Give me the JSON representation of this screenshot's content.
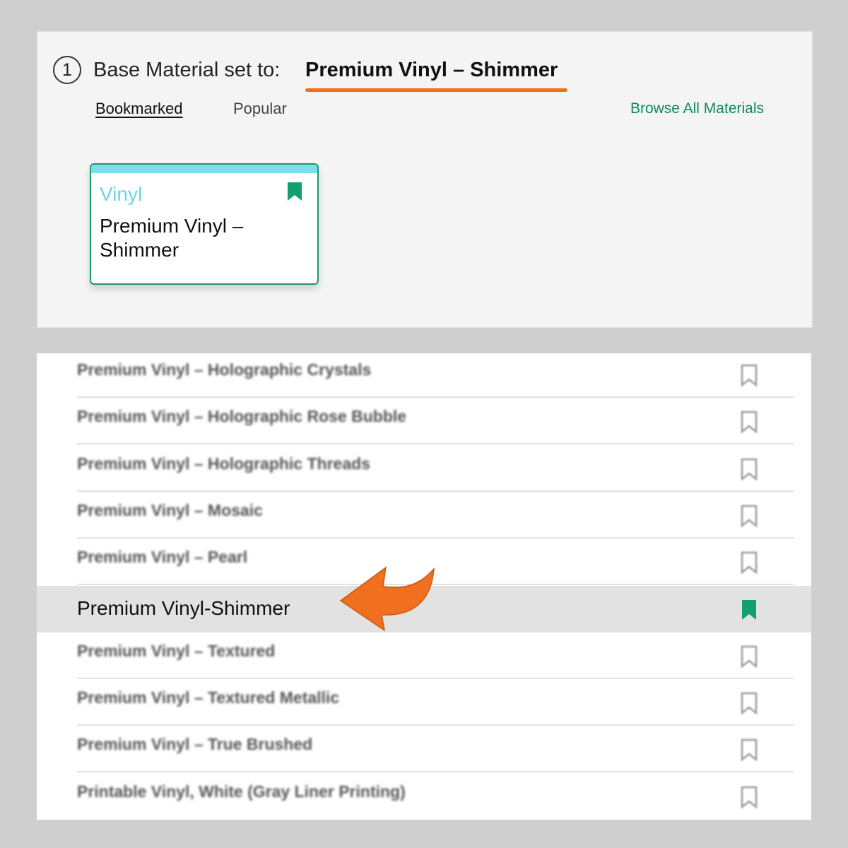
{
  "header": {
    "step_number": "1",
    "label": "Base Material set to:",
    "value": "Premium Vinyl – Shimmer"
  },
  "tabs": [
    {
      "label": "Bookmarked",
      "active": true
    },
    {
      "label": "Popular",
      "active": false
    }
  ],
  "browse_link": "Browse All Materials",
  "card": {
    "category": "Vinyl",
    "title": "Premium Vinyl – Shimmer",
    "bookmarked": true
  },
  "materials_list": [
    {
      "label": "Premium Vinyl – Holographic Crystals",
      "bookmarked": false
    },
    {
      "label": "Premium Vinyl – Holographic Rose Bubble",
      "bookmarked": false
    },
    {
      "label": "Premium Vinyl – Holographic Threads",
      "bookmarked": false
    },
    {
      "label": "Premium Vinyl – Mosaic",
      "bookmarked": false
    },
    {
      "label": "Premium Vinyl – Pearl",
      "bookmarked": false
    },
    {
      "label": "Premium Vinyl-Shimmer",
      "bookmarked": true,
      "selected": true
    },
    {
      "label": "Premium Vinyl – Textured",
      "bookmarked": false
    },
    {
      "label": "Premium Vinyl – Textured Metallic",
      "bookmarked": false
    },
    {
      "label": "Premium Vinyl – True Brushed",
      "bookmarked": false
    },
    {
      "label": "Printable Vinyl, White (Gray Liner Printing)",
      "bookmarked": false
    }
  ],
  "colors": {
    "accent_orange": "#f07020",
    "brand_green": "#0d8a5c",
    "bookmark_green": "#13a06e",
    "category_cyan": "#6dd4df"
  },
  "icons": {
    "bookmark_filled": "bookmark-filled-icon",
    "bookmark_outline": "bookmark-outline-icon",
    "arrow": "curved-arrow-icon"
  }
}
